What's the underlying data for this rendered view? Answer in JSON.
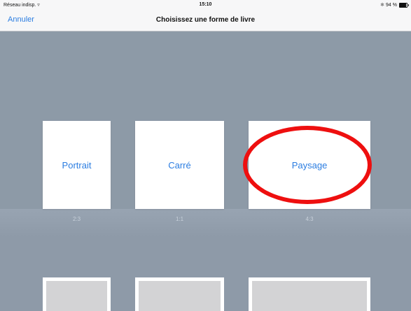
{
  "status_bar": {
    "network": "Réseau indisp.",
    "time": "15:10",
    "battery": "94 %",
    "battery_level": 0.94
  },
  "nav": {
    "cancel_label": "Annuler",
    "title": "Choisissez une forme de livre"
  },
  "shapes": [
    {
      "label": "Portrait",
      "ratio": "2:3"
    },
    {
      "label": "Carré",
      "ratio": "1:1"
    },
    {
      "label": "Paysage",
      "ratio": "4:3"
    }
  ],
  "colors": {
    "accent": "#2b7de1",
    "annotation": "#ee0f0f",
    "background": "#8d9aa7"
  },
  "icons": [
    "wifi-icon",
    "bluetooth-icon",
    "battery-icon"
  ]
}
